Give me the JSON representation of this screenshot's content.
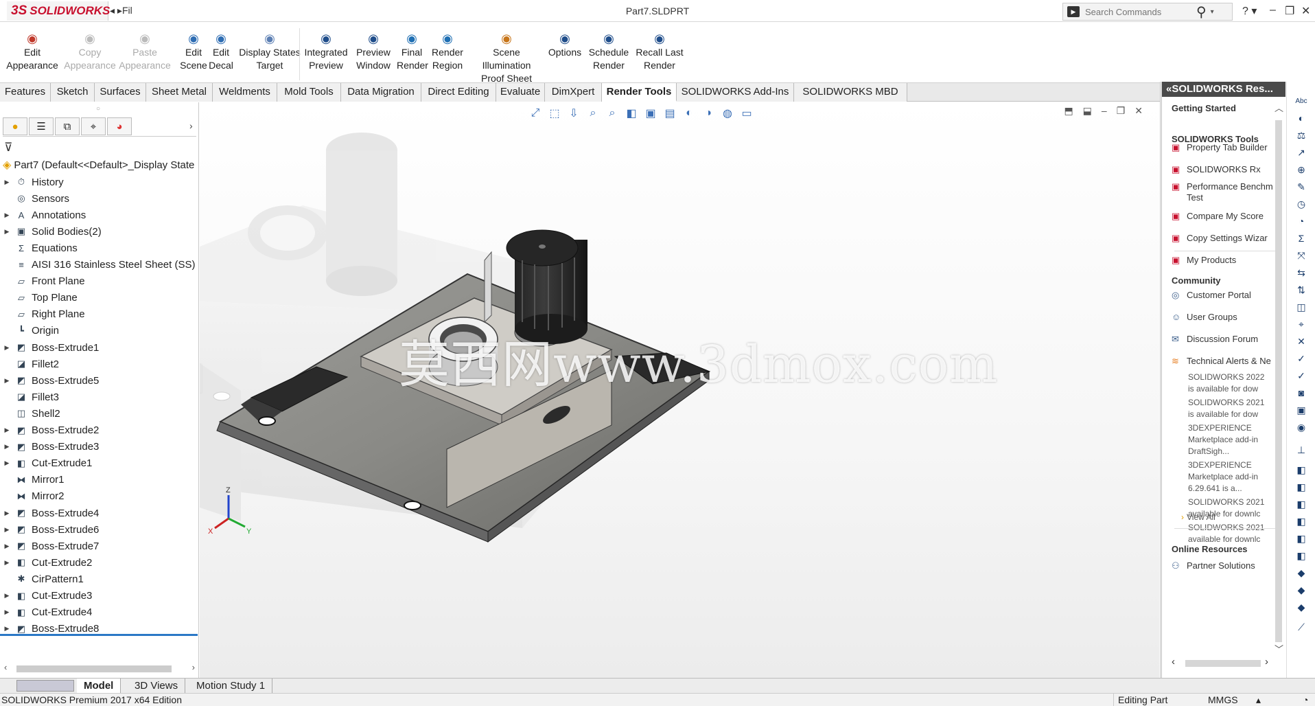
{
  "app": {
    "logo_ds": "3S",
    "logo_name": "SOLIDWORKS",
    "menu_toggle": "◂ ▸Fil",
    "document_title": "Part7.SLDPRT",
    "search_placeholder": "Search Commands",
    "help": "? ▾",
    "minimize": "–",
    "restore": "❐",
    "close": "✕"
  },
  "command_manager": [
    {
      "label1": "Edit",
      "label2": "Appearance",
      "icon": "appearance-icon",
      "disabled": false
    },
    {
      "label1": "Copy",
      "label2": "Appearance",
      "icon": "copy-appearance-icon",
      "disabled": true
    },
    {
      "label1": "Paste",
      "label2": "Appearance",
      "icon": "paste-appearance-icon",
      "disabled": true
    },
    {
      "label1": "Edit",
      "label2": "Scene",
      "icon": "scene-icon",
      "disabled": false
    },
    {
      "label1": "Edit",
      "label2": "Decal",
      "icon": "decal-icon",
      "disabled": false
    },
    {
      "label1": "Display States",
      "label2": "Target",
      "icon": "display-states-icon",
      "disabled": false
    },
    {
      "label1": "Integrated",
      "label2": "Preview",
      "icon": "integrated-preview-icon",
      "disabled": false
    },
    {
      "label1": "Preview",
      "label2": "Window",
      "icon": "preview-window-icon",
      "disabled": false
    },
    {
      "label1": "Final",
      "label2": "Render",
      "icon": "final-render-icon",
      "disabled": false
    },
    {
      "label1": "Render",
      "label2": "Region",
      "icon": "render-region-icon",
      "disabled": false
    },
    {
      "label1": "Scene Illumination",
      "label2": "Proof Sheet",
      "icon": "proof-sheet-icon",
      "disabled": false
    },
    {
      "label1": "Options",
      "label2": "",
      "icon": "options-icon",
      "disabled": false
    },
    {
      "label1": "Schedule",
      "label2": "Render",
      "icon": "schedule-render-icon",
      "disabled": false
    },
    {
      "label1": "Recall Last",
      "label2": "Render",
      "icon": "recall-render-icon",
      "disabled": false
    }
  ],
  "tabs": [
    "Features",
    "Sketch",
    "Surfaces",
    "Sheet Metal",
    "Weldments",
    "Mold Tools",
    "Data Migration",
    "Direct Editing",
    "Evaluate",
    "DimXpert",
    "Render Tools",
    "SOLIDWORKS Add-Ins",
    "SOLIDWORKS MBD"
  ],
  "active_tab": "Render Tools",
  "feature_manager": {
    "root": "Part7  (Default<<Default>_Display State",
    "nodes": [
      {
        "label": "History",
        "expandable": true,
        "icon": "history-icon"
      },
      {
        "label": "Sensors",
        "expandable": false,
        "icon": "sensors-icon"
      },
      {
        "label": "Annotations",
        "expandable": true,
        "icon": "annotations-icon"
      },
      {
        "label": "Solid Bodies(2)",
        "expandable": true,
        "icon": "solid-bodies-icon"
      },
      {
        "label": "Equations",
        "expandable": false,
        "icon": "equations-icon"
      },
      {
        "label": "AISI 316 Stainless Steel Sheet (SS)",
        "expandable": false,
        "icon": "material-icon"
      },
      {
        "label": "Front Plane",
        "expandable": false,
        "icon": "plane-icon"
      },
      {
        "label": "Top Plane",
        "expandable": false,
        "icon": "plane-icon"
      },
      {
        "label": "Right Plane",
        "expandable": false,
        "icon": "plane-icon"
      },
      {
        "label": "Origin",
        "expandable": false,
        "icon": "origin-icon"
      },
      {
        "label": "Boss-Extrude1",
        "expandable": true,
        "icon": "extrude-icon"
      },
      {
        "label": "Fillet2",
        "expandable": false,
        "icon": "fillet-icon"
      },
      {
        "label": "Boss-Extrude5",
        "expandable": true,
        "icon": "extrude-icon"
      },
      {
        "label": "Fillet3",
        "expandable": false,
        "icon": "fillet-icon"
      },
      {
        "label": "Shell2",
        "expandable": false,
        "icon": "shell-icon"
      },
      {
        "label": "Boss-Extrude2",
        "expandable": true,
        "icon": "extrude-icon"
      },
      {
        "label": "Boss-Extrude3",
        "expandable": true,
        "icon": "extrude-icon"
      },
      {
        "label": "Cut-Extrude1",
        "expandable": true,
        "icon": "cut-extrude-icon"
      },
      {
        "label": "Mirror1",
        "expandable": false,
        "icon": "mirror-icon"
      },
      {
        "label": "Mirror2",
        "expandable": false,
        "icon": "mirror-icon"
      },
      {
        "label": "Boss-Extrude4",
        "expandable": true,
        "icon": "extrude-icon"
      },
      {
        "label": "Boss-Extrude6",
        "expandable": true,
        "icon": "extrude-icon"
      },
      {
        "label": "Boss-Extrude7",
        "expandable": true,
        "icon": "extrude-icon"
      },
      {
        "label": "Cut-Extrude2",
        "expandable": true,
        "icon": "cut-extrude-icon"
      },
      {
        "label": "CirPattern1",
        "expandable": false,
        "icon": "pattern-icon"
      },
      {
        "label": "Cut-Extrude3",
        "expandable": true,
        "icon": "cut-extrude-icon"
      },
      {
        "label": "Cut-Extrude4",
        "expandable": true,
        "icon": "cut-extrude-icon"
      },
      {
        "label": "Boss-Extrude8",
        "expandable": true,
        "icon": "extrude-icon"
      }
    ]
  },
  "watermark": "莫西网www.3dmox.com",
  "task_pane": {
    "header": "«SOLIDWORKS Res...",
    "getting_started": "Getting Started",
    "tools_title": "SOLIDWORKS Tools",
    "tools": [
      "Property Tab Builder",
      "SOLIDWORKS Rx",
      "Performance Benchm",
      "Compare My Score",
      "Copy Settings Wizar",
      "My Products"
    ],
    "tools_line2": "Test",
    "community_title": "Community",
    "community": [
      "Customer Portal",
      "User Groups",
      "Discussion Forum",
      "Technical Alerts & Ne"
    ],
    "news": [
      [
        "SOLIDWORKS 2022",
        "is available for dow"
      ],
      [
        "SOLIDWORKS 2021",
        "is available for dow"
      ],
      [
        "3DEXPERIENCE",
        "Marketplace add-in",
        "DraftSigh..."
      ],
      [
        "3DEXPERIENCE",
        "Marketplace add-in",
        "6.29.641 is a..."
      ],
      [
        "SOLIDWORKS 2021",
        "available for downlc"
      ],
      [
        "SOLIDWORKS 2021",
        "available for downlc"
      ]
    ],
    "view_all": "View All",
    "online_title": "Online Resources",
    "online": [
      "Partner Solutions"
    ]
  },
  "bottom_tabs": [
    "Model",
    "3D Views",
    "Motion Study 1"
  ],
  "active_bottom_tab": "Model",
  "status": {
    "edition": "SOLIDWORKS Premium 2017 x64 Edition",
    "mode": "Editing Part",
    "units": "MMGS",
    "units_arrow": "▴"
  }
}
